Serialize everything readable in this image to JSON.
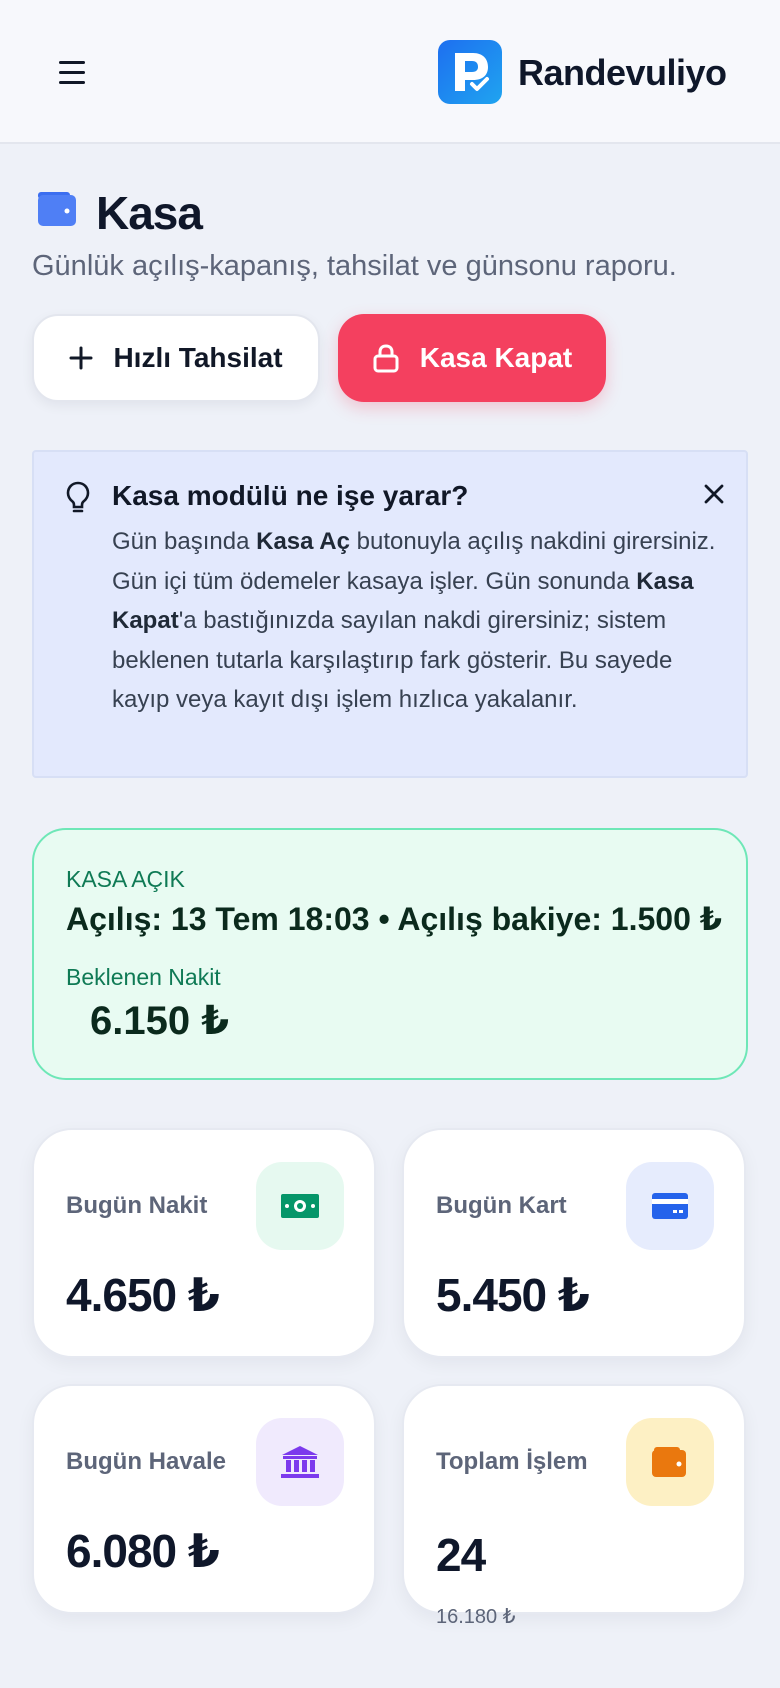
{
  "header": {
    "brand": "Randevuliyo",
    "menu_icon": "hamburger-menu-icon",
    "logo_icon": "randevuliyo-logo"
  },
  "page": {
    "title": "Kasa",
    "title_icon": "wallet-icon",
    "subtitle": "Günlük açılış-kapanış, tahsilat ve günsonu raporu."
  },
  "actions": {
    "quick_payment": "Hızlı Tahsilat",
    "close_register": "Kasa Kapat"
  },
  "info": {
    "title": "Kasa modülü ne işe yarar?",
    "icon": "lightbulb-icon",
    "body_1": "Gün başında ",
    "body_bold_1": "Kasa Aç",
    "body_2": " butonuyla açılış nakdini girersiniz. Gün içi tüm ödemeler kasaya işler. Gün sonunda ",
    "body_bold_2": "Kasa Kapat",
    "body_3": "'a bastığınızda sayılan nakdi girersiniz; sistem beklenen tutarla karşılaştırıp fark gösterir. Bu sayede kayıp veya kayıt dışı işlem hızlıca yakalanır."
  },
  "status": {
    "label": "KASA AÇIK",
    "line": "Açılış: 13 Tem 18:03 • Açılış bakiye: 1.500 ₺",
    "expected_label": "Beklenen Nakit",
    "expected_value": "6.150 ₺",
    "accent": "#6ee7b7"
  },
  "stats": [
    {
      "label": "Bugün Nakit",
      "value": "4.650 ₺",
      "icon": "cash-icon",
      "icon_bg": "#e6f9f0",
      "icon_color": "#059669"
    },
    {
      "label": "Bugün Kart",
      "value": "5.450 ₺",
      "icon": "credit-card-icon",
      "icon_bg": "#e6ecfd",
      "icon_color": "#2563eb"
    },
    {
      "label": "Bugün Havale",
      "value": "6.080 ₺",
      "icon": "bank-icon",
      "icon_bg": "#f0eafd",
      "icon_color": "#7c3aed"
    },
    {
      "label": "Toplam İşlem",
      "value": "24",
      "sub": "16.180 ₺",
      "icon": "wallet-icon",
      "icon_bg": "#fdf0c4",
      "icon_color": "#ea780e"
    }
  ]
}
